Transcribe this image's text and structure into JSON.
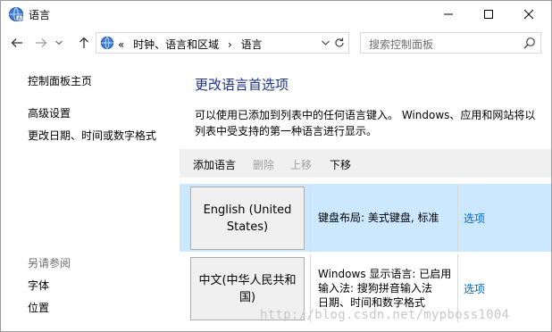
{
  "window": {
    "title": "语言"
  },
  "address": {
    "crumbs": [
      "«",
      "时钟、语言和区域",
      "›",
      "语言"
    ]
  },
  "search": {
    "placeholder": "搜索控制面板"
  },
  "sidebar": {
    "home": "控制面板主页",
    "items": [
      "高级设置",
      "更改日期、时间或数字格式"
    ],
    "see_also_title": "另请参阅",
    "see_also": [
      "字体",
      "位置"
    ]
  },
  "main": {
    "heading": "更改语言首选项",
    "description": "可以使用已添加到列表中的任何语言键入。 Windows、应用和网站将以列表中受支持的第一种语言进行显示。",
    "toolbar": {
      "add": "添加语言",
      "remove": "删除",
      "up": "上移",
      "down": "下移"
    },
    "languages": [
      {
        "name": "English (United States)",
        "details": [
          "键盘布局: 美式键盘, 标准"
        ],
        "options": "选项"
      },
      {
        "name": "中文(中华人民共和国)",
        "details": [
          "Windows 显示语言: 已启用",
          "输入法: 搜狗拼音输入法",
          "日期、时间和数字格式"
        ],
        "options": "选项"
      }
    ]
  },
  "watermark": "http://blog.csdn.net/mypboss1004",
  "colors": {
    "accent_heading": "#1e3287",
    "link": "#0066cc",
    "selection": "#cce8ff"
  }
}
